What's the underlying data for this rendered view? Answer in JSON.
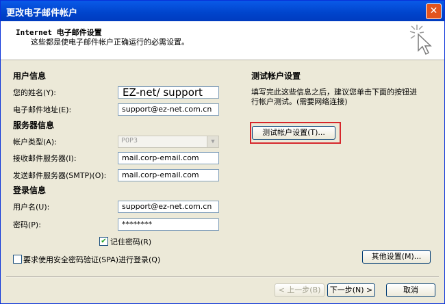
{
  "window": {
    "title": "更改电子邮件帐户",
    "close_label": "✕"
  },
  "header": {
    "title": "Internet 电子邮件设置",
    "subtitle": "这些都是使电子邮件帐户正确运行的必需设置。"
  },
  "user_info": {
    "section": "用户信息",
    "name_label": "您的姓名(Y):",
    "name_value": "EZ-net/ support",
    "email_label": "电子邮件地址(E):",
    "email_value": "support@ez-net.com.cn"
  },
  "server_info": {
    "section": "服务器信息",
    "type_label": "帐户类型(A):",
    "type_value": "POP3",
    "incoming_label": "接收邮件服务器(I):",
    "incoming_value": "mail.corp-email.com",
    "outgoing_label": "发送邮件服务器(SMTP)(O):",
    "outgoing_value": "mail.corp-email.com"
  },
  "login_info": {
    "section": "登录信息",
    "username_label": "用户名(U):",
    "username_value": "support@ez-net.com.cn",
    "password_label": "密码(P):",
    "password_value": "********",
    "remember_label": "记住密码(R)",
    "remember_checked": "✔",
    "spa_label": "要求使用安全密码验证(SPA)进行登录(Q)"
  },
  "test": {
    "section": "测试帐户设置",
    "description_line1": "填写完此这些信息之后，建议您单击下面的按钮进",
    "description_line2": "行帐户测试。(需要网络连接)",
    "button": "测试帐户设置(T)..."
  },
  "more_settings_button": "其他设置(M)...",
  "footer": {
    "back": "< 上一步(B)",
    "next": "下一步(N) >",
    "cancel": "取消"
  }
}
